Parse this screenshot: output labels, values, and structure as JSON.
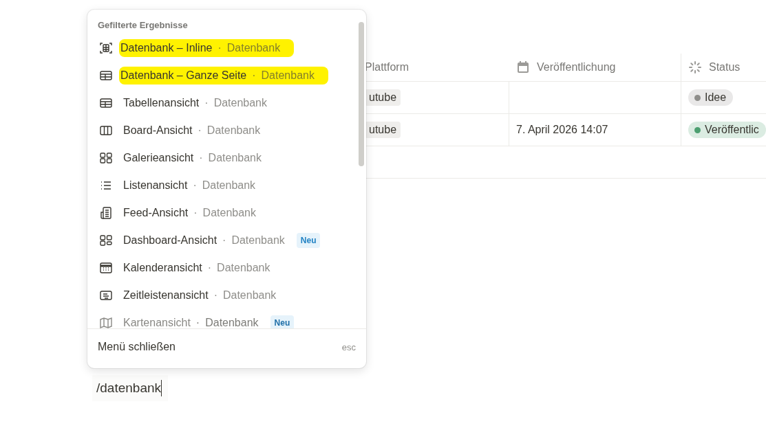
{
  "table": {
    "columns": [
      {
        "label": "Plattform",
        "kind": "text"
      },
      {
        "label": "Veröffentlichung",
        "kind": "date"
      },
      {
        "label": "Status",
        "kind": "status"
      }
    ],
    "rows": [
      {
        "platform": "utube",
        "date": "",
        "status": {
          "label": "Idee",
          "color": "#8f8e8b"
        }
      },
      {
        "platform": "utube",
        "date": "7. April 2026 14:07",
        "status": {
          "label": "Veröffentlic",
          "color": "#4c9f70"
        }
      }
    ]
  },
  "menu": {
    "heading": "Gefilterte Ergebnisse",
    "items": [
      {
        "label": "Datenbank – Inline",
        "separator": "·",
        "hint": "Datenbank",
        "kind": "inline",
        "highlighted": true,
        "faded": false
      },
      {
        "label": "Datenbank – Ganze Seite",
        "separator": "·",
        "hint": "Datenbank",
        "kind": "table",
        "highlighted": true,
        "faded": false
      },
      {
        "label": "Tabellenansicht",
        "separator": "·",
        "hint": "Datenbank",
        "kind": "table",
        "highlighted": false,
        "faded": false
      },
      {
        "label": "Board-Ansicht",
        "separator": "·",
        "hint": "Datenbank",
        "kind": "board",
        "highlighted": false,
        "faded": false
      },
      {
        "label": "Galerieansicht",
        "separator": "·",
        "hint": "Datenbank",
        "kind": "gallery",
        "highlighted": false,
        "faded": false
      },
      {
        "label": "Listenansicht",
        "separator": "·",
        "hint": "Datenbank",
        "kind": "list",
        "highlighted": false,
        "faded": false
      },
      {
        "label": "Feed-Ansicht",
        "separator": "·",
        "hint": "Datenbank",
        "kind": "feed",
        "highlighted": false,
        "faded": false
      },
      {
        "label": "Dashboard-Ansicht",
        "separator": "·",
        "hint": "Datenbank",
        "kind": "dashboard",
        "badge": "Neu",
        "highlighted": false,
        "faded": false
      },
      {
        "label": "Kalenderansicht",
        "separator": "·",
        "hint": "Datenbank",
        "kind": "calendar",
        "highlighted": false,
        "faded": false
      },
      {
        "label": "Zeitleistenansicht",
        "separator": "·",
        "hint": "Datenbank",
        "kind": "timeline",
        "highlighted": false,
        "faded": false
      },
      {
        "label": "Kartenansicht",
        "separator": "·",
        "hint": "Datenbank",
        "kind": "map",
        "badge": "Neu",
        "highlighted": false,
        "faded": true
      }
    ],
    "footer": {
      "label": "Menü schließen",
      "shortcut": "esc"
    }
  },
  "input": {
    "value": "/datenbank"
  }
}
